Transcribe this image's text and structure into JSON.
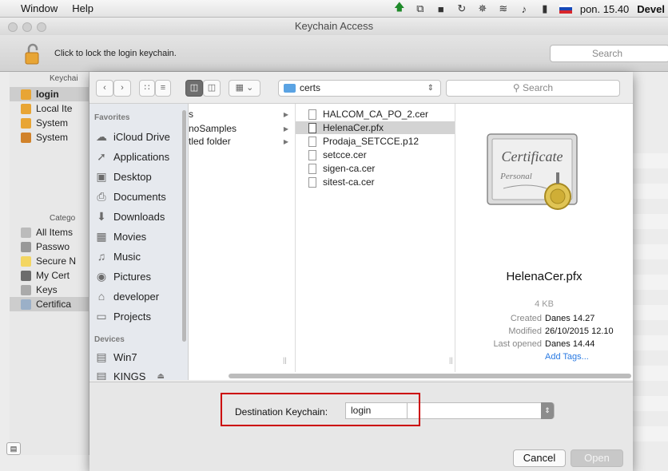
{
  "menubar": {
    "items": [
      "Window",
      "Help"
    ],
    "clock": "pon. 15.40",
    "app_user": "Devel"
  },
  "keychain": {
    "title": "Keychain Access",
    "lock_text": "Click to lock the login keychain.",
    "search_placeholder": "Search",
    "keychains_header": "Keychai",
    "keychains": [
      "login",
      "Local Ite",
      "System",
      "System"
    ],
    "category_header": "Catego",
    "categories": [
      "All Items",
      "Passwo",
      "Secure N",
      "My Cert",
      "Keys",
      "Certifica"
    ]
  },
  "sheet": {
    "path_folder": "certs",
    "search_placeholder": "Search",
    "favorites_header": "Favorites",
    "favorites": [
      {
        "label": "iCloud Drive",
        "icon": "cloud-icon"
      },
      {
        "label": "Applications",
        "icon": "applications-icon"
      },
      {
        "label": "Desktop",
        "icon": "desktop-icon"
      },
      {
        "label": "Documents",
        "icon": "documents-icon"
      },
      {
        "label": "Downloads",
        "icon": "downloads-icon"
      },
      {
        "label": "Movies",
        "icon": "movies-icon"
      },
      {
        "label": "Music",
        "icon": "music-icon"
      },
      {
        "label": "Pictures",
        "icon": "pictures-icon"
      },
      {
        "label": "developer",
        "icon": "home-icon"
      },
      {
        "label": "Projects",
        "icon": "folder-icon"
      }
    ],
    "devices_header": "Devices",
    "devices": [
      {
        "label": "Win7",
        "icon": "disk-icon"
      },
      {
        "label": "KINGS",
        "icon": "disk-icon"
      }
    ],
    "column1": [
      "s",
      "noSamples",
      "tled folder"
    ],
    "column2": [
      "HALCOM_CA_PO_2.cer",
      "HelenaCer.pfx",
      "Prodaja_SETCCE.p12",
      "setcce.cer",
      "sigen-ca.cer",
      "sitest-ca.cer"
    ],
    "selected_file": "HelenaCer.pfx",
    "preview": {
      "name": "HelenaCer.pfx",
      "size": "4 KB",
      "created_label": "Created",
      "created": "Danes 14.27",
      "modified_label": "Modified",
      "modified": "26/10/2015 12.10",
      "last_opened_label": "Last opened",
      "last_opened": "Danes 14.44",
      "add_tags": "Add Tags...",
      "icon_text_1": "Certificate",
      "icon_text_2": "Personal"
    },
    "destination_label": "Destination Keychain:",
    "destination_value": "login",
    "cancel_label": "Cancel",
    "open_label": "Open"
  },
  "colors": {
    "highlight": "#cc0000",
    "link": "#2a7ae2",
    "folder": "#5aa3e3"
  }
}
